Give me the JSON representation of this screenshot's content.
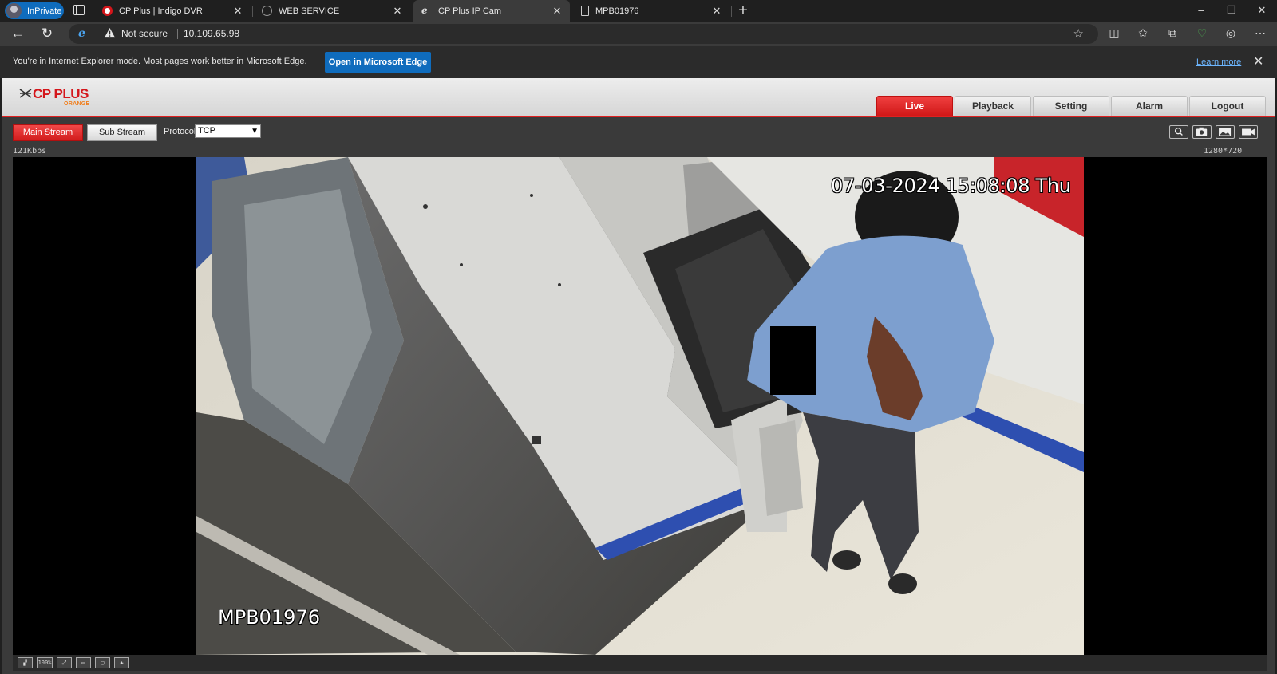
{
  "browser": {
    "inprivate_label": "InPrivate",
    "tabs": [
      {
        "title": "CP Plus | Indigo DVR"
      },
      {
        "title": "WEB SERVICE"
      },
      {
        "title": "CP Plus IP Cam"
      },
      {
        "title": "MPB01976"
      }
    ],
    "address": {
      "security_label": "Not secure",
      "url": "10.109.65.98"
    },
    "ie_mode_bar": {
      "message": "You're in Internet Explorer mode. Most pages work better in Microsoft Edge.",
      "open_button": "Open in Microsoft Edge",
      "learn_more": "Learn more"
    }
  },
  "app": {
    "logo_text": "CP PLUS",
    "logo_subtext": "ORANGE",
    "nav": [
      {
        "label": "Live"
      },
      {
        "label": "Playback"
      },
      {
        "label": "Setting"
      },
      {
        "label": "Alarm"
      },
      {
        "label": "Logout"
      }
    ],
    "active_nav": "Live",
    "stream": {
      "main_label": "Main Stream",
      "sub_label": "Sub Stream",
      "protocol_label": "Protocol",
      "protocol_value": "TCP"
    },
    "bitrate": "121Kbps",
    "resolution": "1280*720",
    "video": {
      "timestamp": "07-03-2024 15:08:08 Thu",
      "camera_name": "MPB01976"
    },
    "zoom_label": "100%",
    "colors": {
      "accent_red": "#d4161b",
      "edge_blue": "#0f6cbd"
    }
  }
}
